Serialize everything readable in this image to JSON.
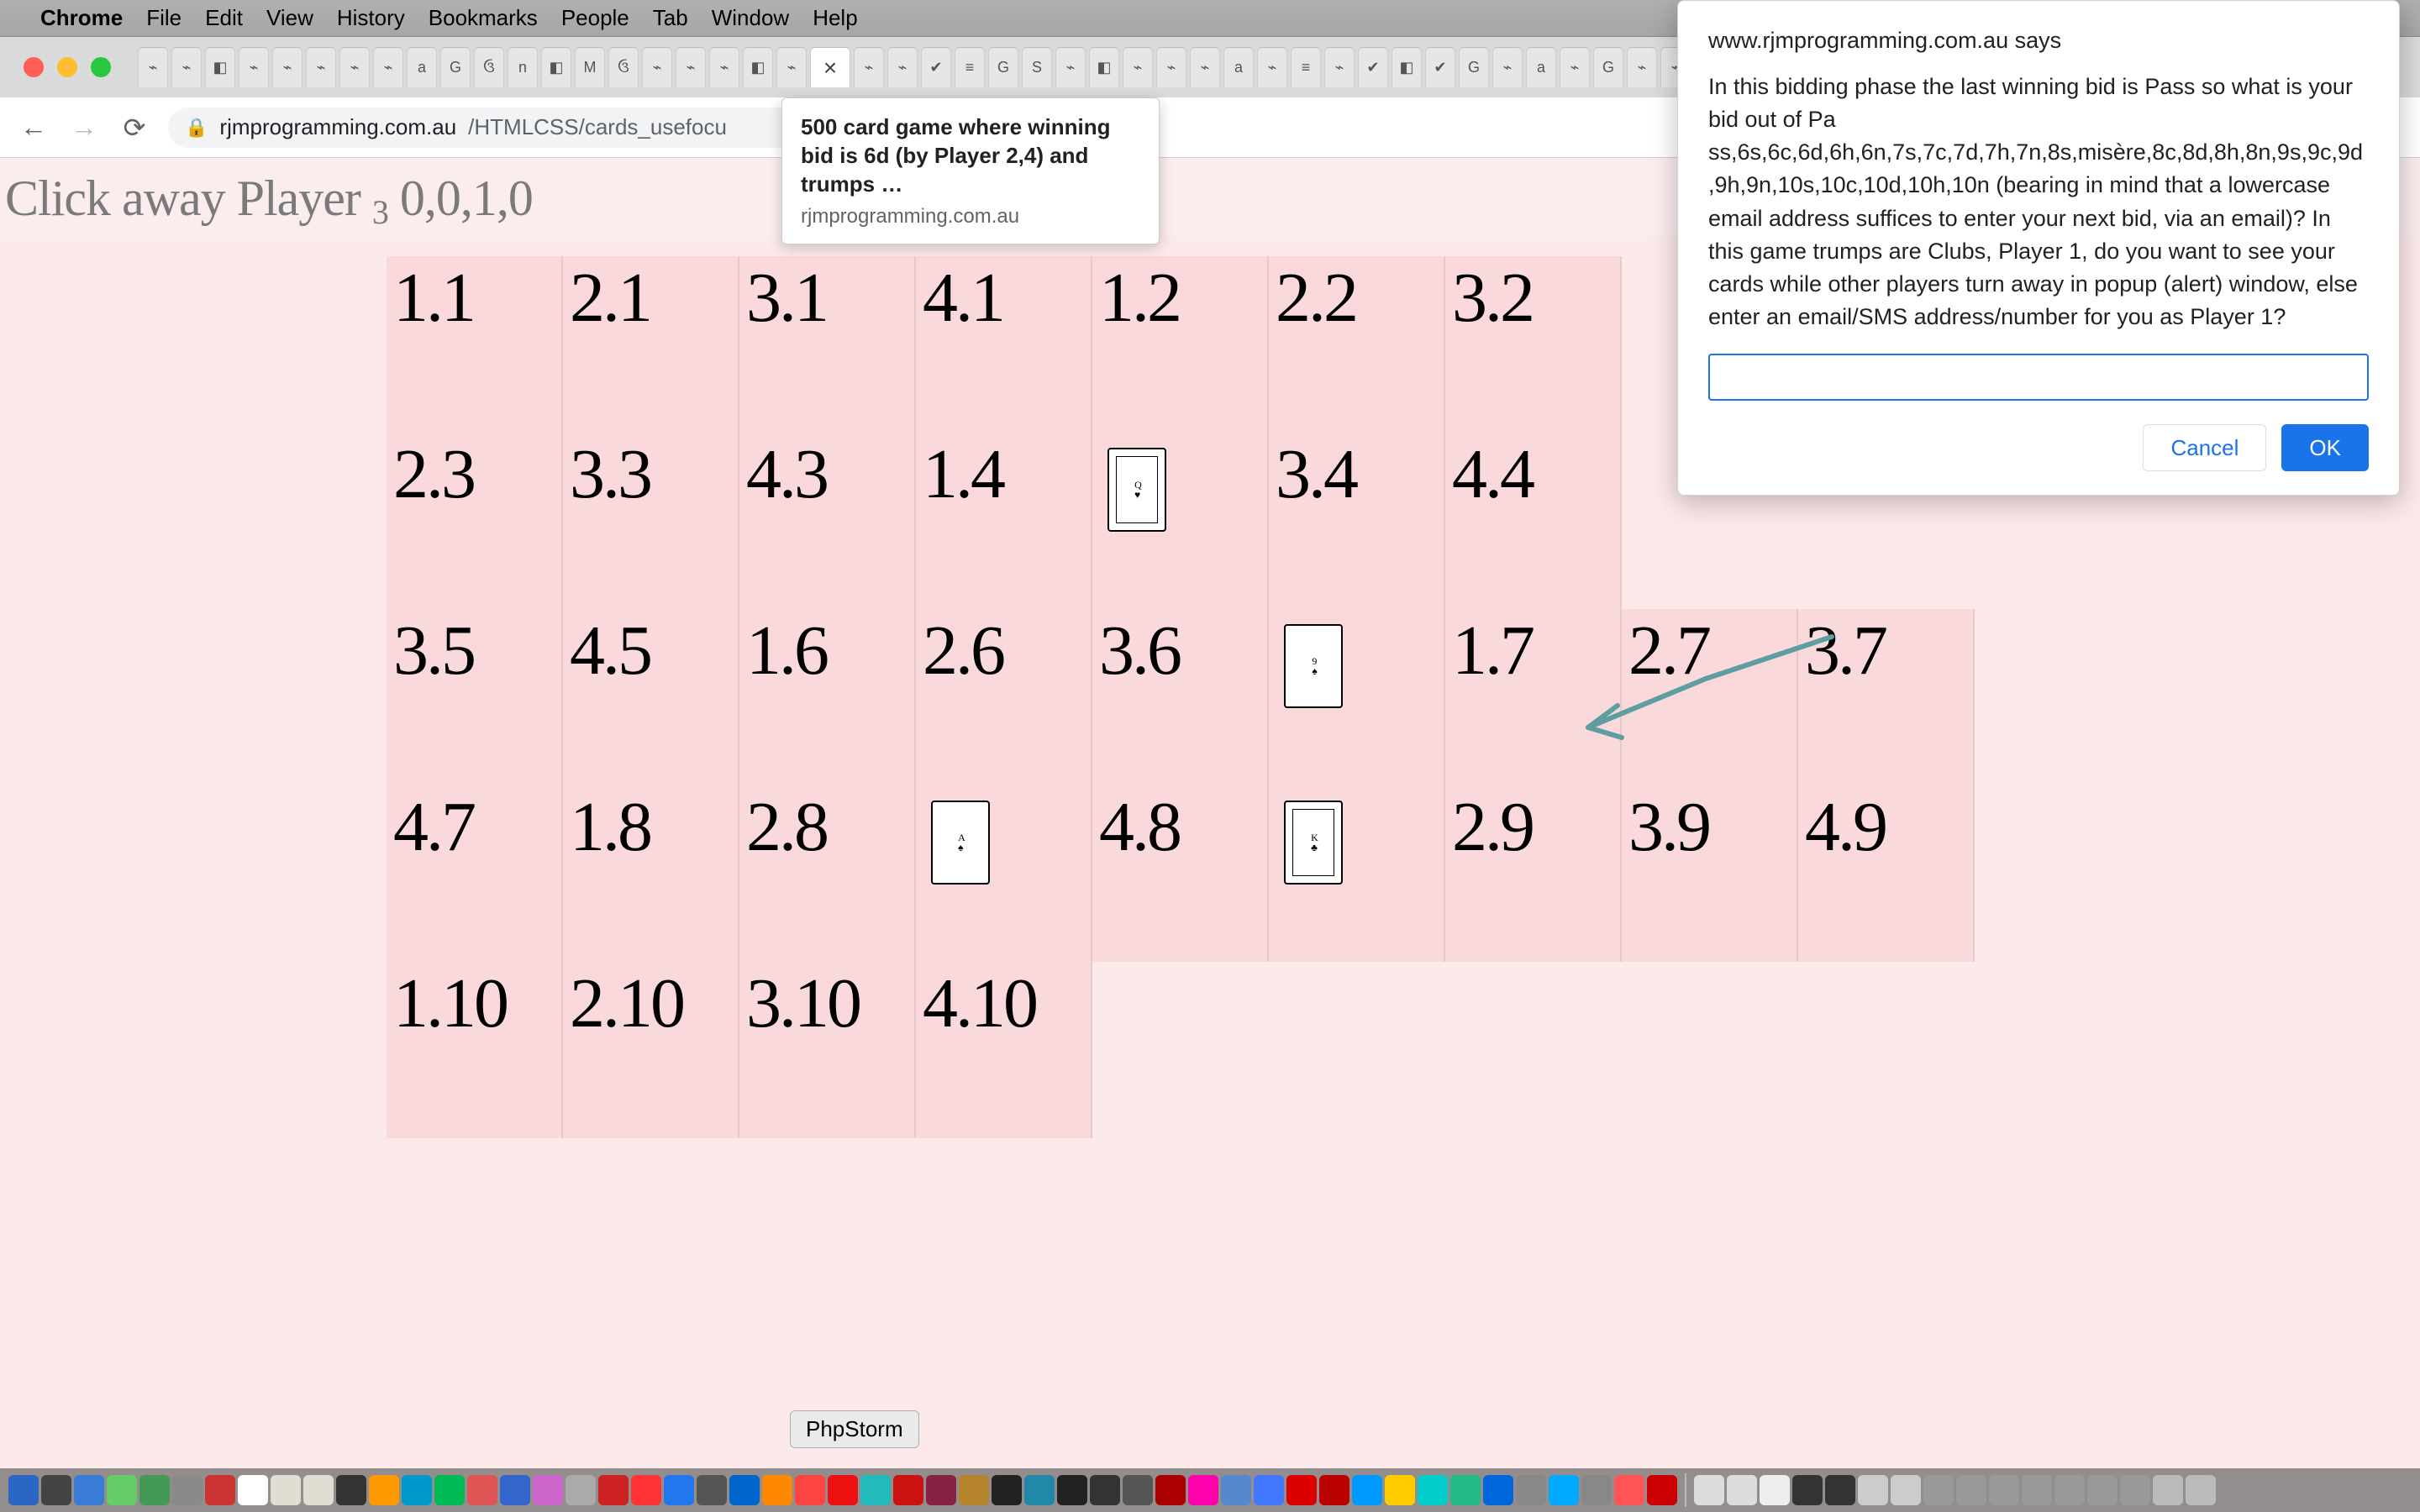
{
  "menubar": {
    "app": "Chrome",
    "items": [
      "File",
      "Edit",
      "View",
      "History",
      "Bookmarks",
      "People",
      "Tab",
      "Window",
      "Help"
    ]
  },
  "chrome": {
    "url_host": "rjmprogramming.com.au",
    "url_path": "/HTMLCSS/cards_usefocu",
    "tab_tooltip_title": "500 card game where winning bid is 6d (by Player 2,4) and trumps …",
    "tab_tooltip_domain": "rjmprogramming.com.au",
    "close_glyph": "×"
  },
  "page": {
    "header_prefix": "Click away Player ",
    "header_sub": "3",
    "header_suffix": " 0,0,1,0",
    "grid": [
      [
        "1.1",
        "2.1",
        "3.1",
        "4.1",
        "1.2",
        "2.2",
        "3.2",
        "",
        ""
      ],
      [
        "2.3",
        "3.3",
        "4.3",
        "1.4",
        "CARD_QH",
        "3.4",
        "4.4",
        "",
        ""
      ],
      [
        "3.5",
        "4.5",
        "1.6",
        "2.6",
        "3.6",
        "CARD_9S",
        "1.7",
        "2.7",
        "3.7"
      ],
      [
        "4.7",
        "1.8",
        "2.8",
        "CARD_AS",
        "4.8",
        "CARD_KC",
        "2.9",
        "3.9",
        "4.9"
      ],
      [
        "1.10",
        "2.10",
        "3.10",
        "4.10",
        "",
        "",
        "",
        "",
        ""
      ]
    ],
    "cards": {
      "CARD_QH": {
        "rank": "Q",
        "suit": "♥",
        "face": true
      },
      "CARD_9S": {
        "rank": "9",
        "suit": "♠",
        "face": false
      },
      "CARD_AS": {
        "rank": "A",
        "suit": "♠",
        "face": false
      },
      "CARD_KC": {
        "rank": "K",
        "suit": "♣",
        "face": true
      }
    }
  },
  "dialog": {
    "origin": "www.rjmprogramming.com.au says",
    "message": "In this bidding phase the last winning bid is Pass so what is your bid out of Pa ss,6s,6c,6d,6h,6n,7s,7c,7d,7h,7n,8s,misère,8c,8d,8h,8n,9s,9c,9d,9h,9n,10s,10c,10d,10h,10n (bearing in mind that a lowercase email address suffices to enter your next bid, via an email)?   In this game trumps are Clubs, Player 1, do you want to see your cards while other players turn away in popup (alert) window, else enter an email/SMS address/number for you as Player 1?",
    "input_value": "",
    "cancel": "Cancel",
    "ok": "OK"
  },
  "dock": {
    "hover_label": "PhpStorm"
  }
}
